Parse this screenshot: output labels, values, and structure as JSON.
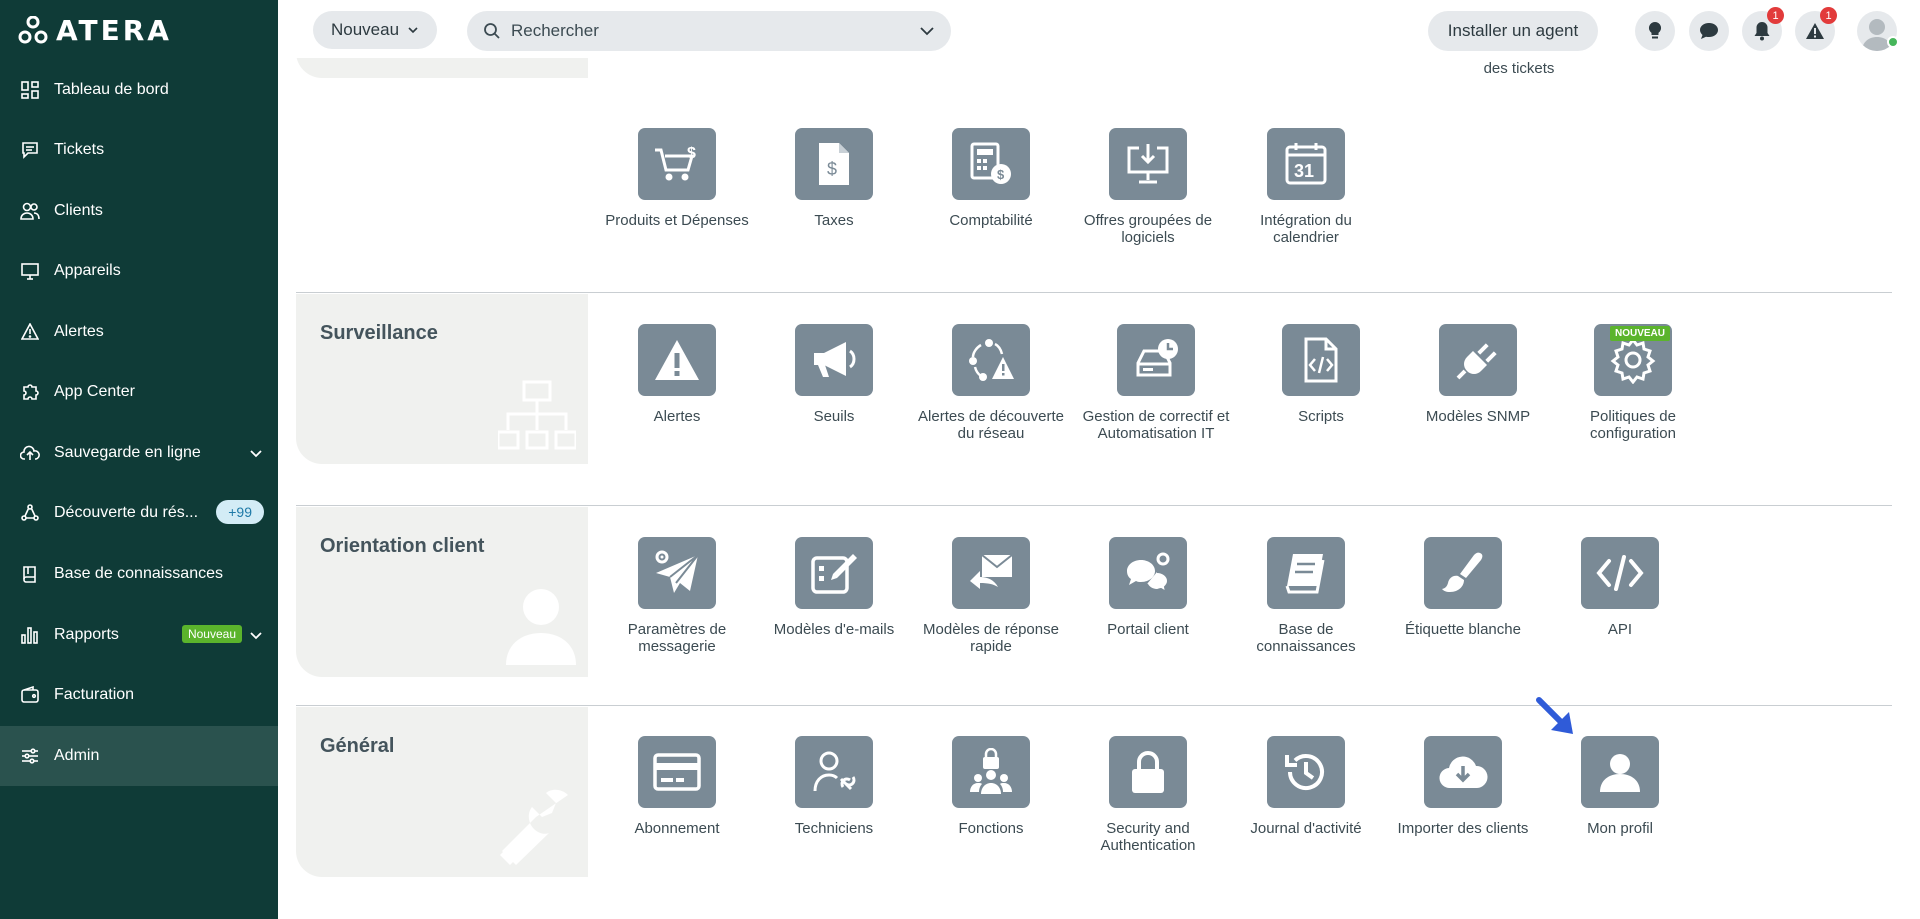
{
  "brand": {
    "logo_text": "ATERA"
  },
  "sidebar": {
    "items": [
      {
        "label": "Tableau de bord"
      },
      {
        "label": "Tickets"
      },
      {
        "label": "Clients"
      },
      {
        "label": "Appareils"
      },
      {
        "label": "Alertes"
      },
      {
        "label": "App Center"
      },
      {
        "label": "Sauvegarde en ligne"
      },
      {
        "label": "Découverte du rés...",
        "badge": "+99"
      },
      {
        "label": "Base de connaissances"
      },
      {
        "label": "Rapports",
        "badge": "Nouveau"
      },
      {
        "label": "Facturation"
      },
      {
        "label": "Admin"
      }
    ]
  },
  "topbar": {
    "new_label": "Nouveau",
    "search_placeholder": "Rechercher",
    "install_label": "Installer un agent",
    "notif_bell_count": "1",
    "notif_alert_count": "1"
  },
  "billing": {
    "prev_label": "des tickets",
    "tiles": [
      {
        "label": "Produits et Dépenses",
        "icon": "cart-dollar-icon"
      },
      {
        "label": "Taxes",
        "icon": "document-dollar-icon"
      },
      {
        "label": "Comptabilité",
        "icon": "calculator-icon"
      },
      {
        "label": "Offres groupées de logiciels",
        "icon": "download-monitor-icon"
      },
      {
        "label": "Intégration du calendrier",
        "icon": "calendar-icon"
      }
    ]
  },
  "sections": [
    {
      "title": "Surveillance",
      "tiles": [
        {
          "label": "Alertes",
          "icon": "warning-icon"
        },
        {
          "label": "Seuils",
          "icon": "megaphone-icon"
        },
        {
          "label": "Alertes de découverte du réseau",
          "icon": "network-alert-icon"
        },
        {
          "label": "Gestion de correctif et Automatisation IT",
          "icon": "drive-clock-icon"
        },
        {
          "label": "Scripts",
          "icon": "script-icon"
        },
        {
          "label": "Modèles SNMP",
          "icon": "plug-icon"
        },
        {
          "label": "Politiques de configuration",
          "icon": "gear-icon",
          "tag": "NOUVEAU"
        }
      ]
    },
    {
      "title": "Orientation client",
      "tiles": [
        {
          "label": "Paramètres de messagerie",
          "icon": "paper-plane-gear-icon"
        },
        {
          "label": "Modèles d'e-mails",
          "icon": "edit-form-icon"
        },
        {
          "label": "Modèles de réponse rapide",
          "icon": "mail-reply-icon"
        },
        {
          "label": "Portail client",
          "icon": "chat-gear-icon"
        },
        {
          "label": "Base de connaissances",
          "icon": "book-icon"
        },
        {
          "label": "Étiquette blanche",
          "icon": "brush-icon"
        },
        {
          "label": "API",
          "icon": "code-icon"
        }
      ]
    },
    {
      "title": "Général",
      "tiles": [
        {
          "label": "Abonnement",
          "icon": "credit-card-icon"
        },
        {
          "label": "Techniciens",
          "icon": "technician-icon"
        },
        {
          "label": "Fonctions",
          "icon": "group-lock-icon"
        },
        {
          "label": "Security and Authentication",
          "icon": "lock-icon"
        },
        {
          "label": "Journal d'activité",
          "icon": "history-icon"
        },
        {
          "label": "Importer des clients",
          "icon": "cloud-download-icon"
        },
        {
          "label": "Mon profil",
          "icon": "user-icon"
        }
      ]
    }
  ],
  "colors": {
    "sidebar_bg": "#0f3b37",
    "sidebar_active": "#2a524e",
    "tile_bg": "#7a8a96",
    "panel_bg": "#f0f1ef",
    "badge_green": "#5bb42c",
    "notif_red": "#e23b3b",
    "arrow_blue": "#2f5bd8"
  }
}
